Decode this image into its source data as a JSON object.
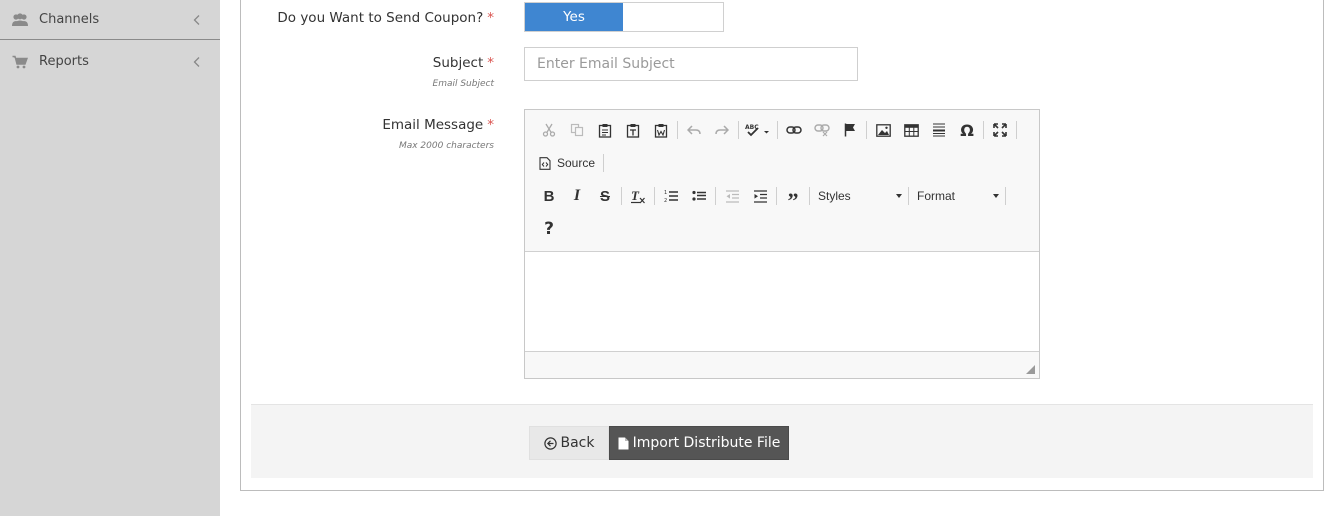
{
  "sidebar": {
    "items": [
      {
        "label": "Channels",
        "icon": "users-icon"
      },
      {
        "label": "Reports",
        "icon": "cart-icon"
      }
    ]
  },
  "form": {
    "coupon": {
      "label": "Do you Want to Send Coupon?",
      "required": "*",
      "toggle_value": "Yes"
    },
    "subject": {
      "label": "Subject",
      "required": "*",
      "hint": "Email Subject",
      "placeholder": "Enter Email Subject"
    },
    "message": {
      "label": "Email Message",
      "required": "*",
      "hint": "Max 2000 characters"
    }
  },
  "editor": {
    "source_label": "Source",
    "styles_label": "Styles",
    "format_label": "Format",
    "help_label": "?"
  },
  "footer": {
    "back_label": "Back",
    "import_label": "Import Distribute File"
  },
  "colors": {
    "toggle_on": "#3f86d1",
    "required": "#d9534f",
    "import_button": "#555555",
    "sidebar": "#d6d6d6"
  }
}
